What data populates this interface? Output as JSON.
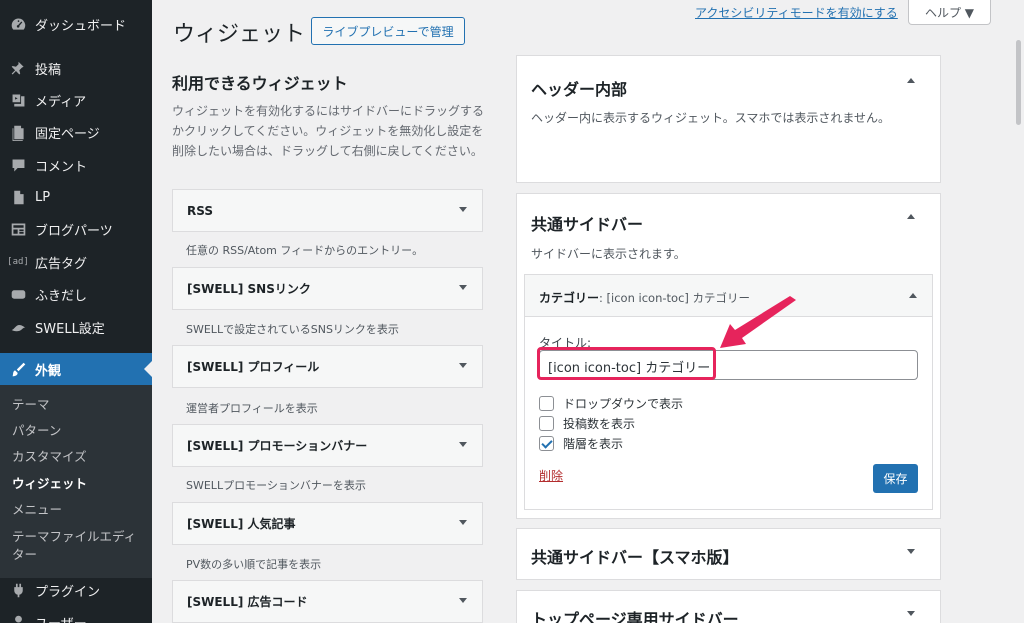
{
  "sidebar": {
    "items": [
      {
        "label": "ダッシュボード",
        "icon": "dashboard-icon"
      },
      {
        "label": "投稿",
        "icon": "pin-icon"
      },
      {
        "label": "メディア",
        "icon": "media-icon"
      },
      {
        "label": "固定ページ",
        "icon": "page-icon"
      },
      {
        "label": "コメント",
        "icon": "comment-icon"
      },
      {
        "label": "LP",
        "icon": "document-icon"
      },
      {
        "label": "ブログパーツ",
        "icon": "blog-parts-icon"
      },
      {
        "label": "広告タグ",
        "icon": "ad-icon",
        "icon_text": "[ad]"
      },
      {
        "label": "ふきだし",
        "icon": "balloon-icon"
      },
      {
        "label": "SWELL設定",
        "icon": "swell-icon"
      },
      {
        "label": "外観",
        "icon": "brush-icon"
      },
      {
        "label": "プラグイン",
        "icon": "plugin-icon"
      },
      {
        "label": "ユーザー",
        "icon": "user-icon"
      }
    ],
    "submenu": [
      "テーマ",
      "パターン",
      "カスタマイズ",
      "ウィジェット",
      "メニュー",
      "テーマファイルエディター"
    ]
  },
  "header": {
    "title": "ウィジェット",
    "live_preview": "ライブプレビューで管理",
    "accessibility_link": "アクセシビリティモードを有効にする",
    "help": "ヘルプ ▼"
  },
  "available": {
    "title": "利用できるウィジェット",
    "description": "ウィジェットを有効化するにはサイドバーにドラッグするかクリックしてください。ウィジェットを無効化し設定を削除したい場合は、ドラッグして右側に戻してください。",
    "widgets": [
      {
        "name": "RSS",
        "desc": "任意の RSS/Atom フィードからのエントリー。"
      },
      {
        "name": "[SWELL] SNSリンク",
        "desc": "SWELLで設定されているSNSリンクを表示"
      },
      {
        "name": "[SWELL] プロフィール",
        "desc": "運営者プロフィールを表示"
      },
      {
        "name": "[SWELL] プロモーションバナー",
        "desc": "SWELLプロモーションバナーを表示"
      },
      {
        "name": "[SWELL] 人気記事",
        "desc": "PV数の多い順で記事を表示"
      },
      {
        "name": "[SWELL] 広告コード",
        "desc": ""
      }
    ]
  },
  "areas": {
    "header_inner": {
      "title": "ヘッダー内部",
      "desc": "ヘッダー内に表示するウィジェット。スマホでは表示されません。"
    },
    "common_sidebar": {
      "title": "共通サイドバー",
      "desc": "サイドバーに表示されます。"
    },
    "sp_sidebar": {
      "title": "共通サイドバー【スマホ版】"
    },
    "top_sidebar": {
      "title": "トップページ専用サイドバー"
    }
  },
  "open_widget": {
    "title_main": "カテゴリー",
    "title_sub": ": [icon icon-toc] カテゴリー",
    "label": "タイトル:",
    "value": "[icon icon-toc] カテゴリー",
    "options": [
      {
        "label": "ドロップダウンで表示",
        "checked": false
      },
      {
        "label": "投稿数を表示",
        "checked": false
      },
      {
        "label": "階層を表示",
        "checked": true
      }
    ],
    "delete": "削除",
    "save": "保存"
  },
  "colors": {
    "accent": "#2271b1",
    "highlight": "#e6245c",
    "admin_bar": "#1d2327"
  }
}
